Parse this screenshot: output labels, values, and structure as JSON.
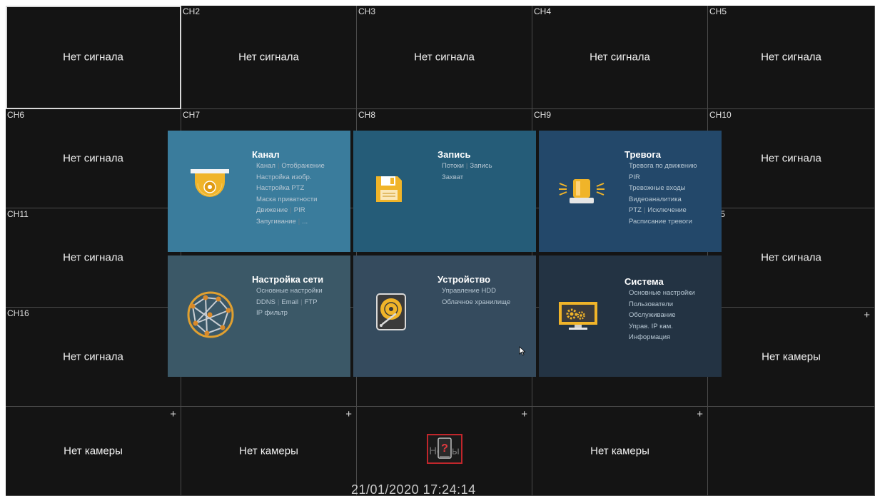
{
  "grid": {
    "rows": [
      [
        {
          "label": "",
          "message": "Нет сигнала",
          "selected": true
        },
        {
          "label": "CH2",
          "message": "Нет сигнала"
        },
        {
          "label": "CH3",
          "message": "Нет сигнала"
        },
        {
          "label": "CH4",
          "message": "Нет сигнала"
        },
        {
          "label": "CH5",
          "message": "Нет сигнала"
        }
      ],
      [
        {
          "label": "CH6",
          "message": "Нет сигнала"
        },
        {
          "label": "CH7",
          "message": ""
        },
        {
          "label": "CH8",
          "message": ""
        },
        {
          "label": "CH9",
          "message": ""
        },
        {
          "label": "CH10",
          "message": "Нет сигнала"
        }
      ],
      [
        {
          "label": "CH11",
          "message": "Нет сигнала"
        },
        {
          "label": "",
          "message": ""
        },
        {
          "label": "",
          "message": ""
        },
        {
          "label": "",
          "message": ""
        },
        {
          "label": "H15",
          "message": "Нет сигнала"
        }
      ],
      [
        {
          "label": "CH16",
          "message": "Нет сигнала"
        },
        {
          "label": "",
          "message": ""
        },
        {
          "label": "",
          "message": ""
        },
        {
          "label": "",
          "message": ""
        },
        {
          "label": "",
          "message": "Нет камеры",
          "plus": true
        }
      ],
      [
        {
          "label": "",
          "message": "Нет камеры",
          "plus": true
        },
        {
          "label": "",
          "message": "Нет камеры",
          "plus": true
        },
        {
          "label": "",
          "message": "Не      ры",
          "plus": true
        },
        {
          "label": "",
          "message": "Нет камеры",
          "plus": true
        },
        {
          "label": "",
          "message": ""
        }
      ]
    ]
  },
  "menu": {
    "tiles": [
      {
        "key": "channel",
        "title": "Канал",
        "icon": "dome-camera-icon",
        "bg": "#3a7c9c",
        "items": [
          [
            "Канал",
            "Отображение"
          ],
          [
            "Настройка изобр."
          ],
          [
            "Настройка PTZ"
          ],
          [
            "Маска приватности"
          ],
          [
            "Движение",
            "PIR"
          ],
          [
            "Запугивание",
            "..."
          ]
        ]
      },
      {
        "key": "record",
        "title": "Запись",
        "icon": "floppy-disk-icon",
        "bg": "#255c78",
        "items": [
          [
            "Потоки",
            "Запись"
          ],
          [
            "Захват"
          ]
        ]
      },
      {
        "key": "alarm",
        "title": "Тревога",
        "icon": "alarm-light-icon",
        "bg": "#23486a",
        "items": [
          [
            "Тревога по движению"
          ],
          [
            "PIR"
          ],
          [
            "Тревожные входы"
          ],
          [
            "Видеоаналитика"
          ],
          [
            "PTZ",
            "Исключение"
          ],
          [
            "Расписание тревоги"
          ]
        ]
      },
      {
        "key": "network",
        "title": "Настройка сети",
        "icon": "network-globe-icon",
        "bg": "#3b5867",
        "items": [
          [
            "Основные настройки"
          ],
          [
            "DDNS",
            "Email",
            "FTP"
          ],
          [
            "IP фильтр"
          ]
        ]
      },
      {
        "key": "device",
        "title": "Устройство",
        "icon": "hard-disk-icon",
        "bg": "#354b5e",
        "items": [
          [
            "Управление HDD"
          ],
          [
            "Облачное хранилище"
          ]
        ]
      },
      {
        "key": "system",
        "title": "Система",
        "icon": "monitor-gears-icon",
        "bg": "#233343",
        "items": [
          [
            "Основные настройки"
          ],
          [
            "Пользователи"
          ],
          [
            "Обслуживание"
          ],
          [
            "Управ. IP кам."
          ],
          [
            "Информация"
          ]
        ]
      }
    ]
  },
  "status": {
    "datetime": "21/01/2020 17:24:14",
    "hdd_warning_icon": "hdd-unknown-warning-icon",
    "hdd_warning_color": "#c0262b"
  }
}
